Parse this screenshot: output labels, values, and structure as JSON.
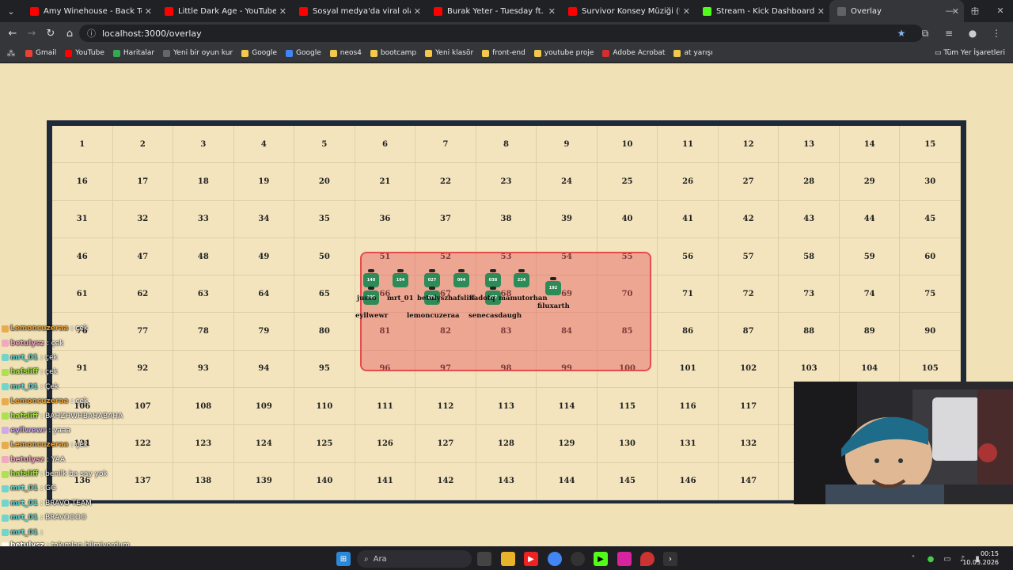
{
  "tabs": [
    {
      "title": "Amy Winehouse - Back To Black",
      "color": "#ff0000",
      "active": false
    },
    {
      "title": "Little Dark Age - YouTube",
      "color": "#ff0000",
      "active": false
    },
    {
      "title": "Sosyal medya'da viral olan - da",
      "color": "#ff0000",
      "active": false
    },
    {
      "title": "Burak Yeter - Tuesday ft. Danel",
      "color": "#ff0000",
      "active": false
    },
    {
      "title": "Survivor Konsey Müziği (Uzun V",
      "color": "#ff0000",
      "active": false
    },
    {
      "title": "Stream - Kick Dashboard",
      "color": "#53fc18",
      "active": false
    },
    {
      "title": "Overlay",
      "color": "#5f6368",
      "active": true
    }
  ],
  "url": "localhost:3000/overlay",
  "bookmarks": [
    "Gmail",
    "YouTube",
    "Haritalar",
    "Yeni bir oyun kur",
    "Google",
    "Google",
    "neos4",
    "bootcamp",
    "Yeni klasör",
    "front-end",
    "youtube proje",
    "Adobe Acrobat",
    "at yarışı"
  ],
  "all_bookmarks": "Tüm Yer İşaretleri",
  "grid": {
    "start": 1,
    "end": 150,
    "columns": 15
  },
  "players": [
    {
      "label": "140",
      "name": "jusso"
    },
    {
      "label": "104",
      "name": "mrt_01"
    },
    {
      "label": "027",
      "name": "betulysz"
    },
    {
      "label": "094",
      "name": "hafsliff"
    },
    {
      "label": "038",
      "name": "sadofq"
    },
    {
      "label": "224",
      "name": "mamutorhan"
    },
    {
      "label": "192",
      "name": "filuxarth"
    },
    {
      "label": "205",
      "name": "eyllwewr"
    },
    {
      "label": "096",
      "name": "lemoncuzeraa"
    },
    {
      "label": "297",
      "name": "senecasdaugh"
    }
  ],
  "name_labels": [
    "jusso",
    "mrt_01",
    "betulysz",
    "hafsliff",
    "sadofq",
    "mamutorhan",
    "filuxarth",
    "eyllwewr",
    "lemoncuzeraa",
    "senecasdaugh"
  ],
  "chat": [
    {
      "user": "Lemoncuzeraa",
      "text": "çek",
      "color": "#e6a23c"
    },
    {
      "user": "betulysz",
      "text": "çek",
      "color": "#f0a0c0"
    },
    {
      "user": "mrt_01",
      "text": "çek",
      "color": "#5ad2d2"
    },
    {
      "user": "hafsliff",
      "text": "çek",
      "color": "#a0e040"
    },
    {
      "user": "mrt_01",
      "text": "Çek",
      "color": "#5ad2d2"
    },
    {
      "user": "Lemoncuzeraa",
      "text": "çek",
      "color": "#e6a23c"
    },
    {
      "user": "hafsliff",
      "text": "BAHZHWHBAHABAHA",
      "color": "#a0e040"
    },
    {
      "user": "eyllwewr",
      "text": "yaaa",
      "color": "#c8a0f0"
    },
    {
      "user": "Lemoncuzeraa",
      "text": "çek",
      "color": "#e6a23c"
    },
    {
      "user": "betulysz",
      "text": "YAA",
      "color": "#f0a0c0"
    },
    {
      "user": "hafsliff",
      "text": "benilk ba say yok",
      "color": "#a0e040"
    },
    {
      "user": "mrt_01",
      "text": "GG",
      "color": "#5ad2d2"
    },
    {
      "user": "mrt_01",
      "text": "BRAVO TEAM",
      "color": "#5ad2d2"
    },
    {
      "user": "mrt_01",
      "text": "BRAVOOOO",
      "color": "#5ad2d2"
    },
    {
      "user": "mrt_01",
      "text": "",
      "color": "#5ad2d2"
    },
    {
      "user": "betulysz",
      "text": "takımları bilmiyordum",
      "color": "#ffffff"
    }
  ],
  "taskbar": {
    "search": "Ara",
    "time": "00:15",
    "date": "10.03.2026"
  }
}
